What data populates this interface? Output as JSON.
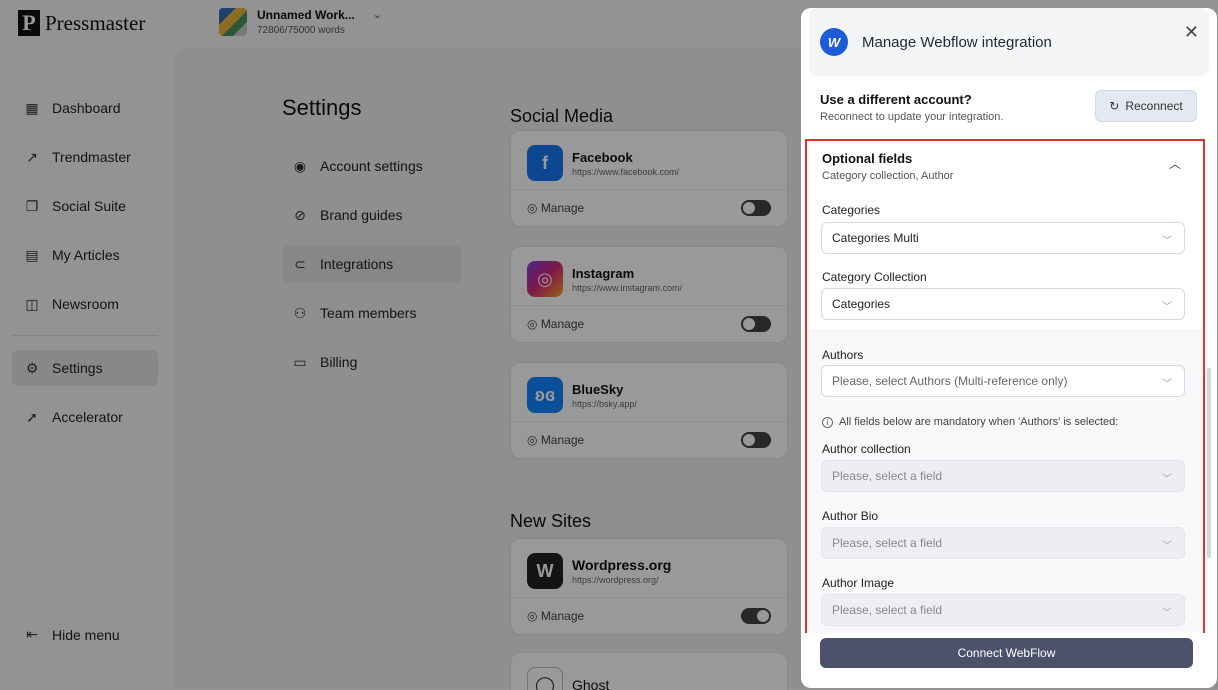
{
  "app": {
    "logo_letter": "P",
    "logo_text": "Pressmaster",
    "workspace_name": "Unnamed Work...",
    "workspace_words": "72806/75000 words"
  },
  "sidebar": {
    "items": [
      {
        "label": "Dashboard",
        "icon": "grid-icon"
      },
      {
        "label": "Trendmaster",
        "icon": "trend-icon"
      },
      {
        "label": "Social Suite",
        "icon": "stack-icon"
      },
      {
        "label": "My Articles",
        "icon": "article-icon"
      },
      {
        "label": "Newsroom",
        "icon": "newsroom-icon"
      },
      {
        "label": "Settings",
        "icon": "gear-icon"
      },
      {
        "label": "Accelerator",
        "icon": "rocket-icon"
      }
    ],
    "hide_menu": "Hide menu"
  },
  "settings": {
    "title": "Settings",
    "menu": [
      "Account settings",
      "Brand guides",
      "Integrations",
      "Team members",
      "Billing"
    ]
  },
  "social_media": {
    "title": "Social Media",
    "cards": [
      {
        "name": "Facebook",
        "url": "https://www.facebook.com/",
        "manage": "Manage",
        "color": "#1877f2"
      },
      {
        "name": "Instagram",
        "url": "https://www.instagram.com/",
        "manage": "Manage",
        "color": "#d6287a"
      },
      {
        "name": "BlueSky",
        "url": "https://bsky.app/",
        "manage": "Manage",
        "color": "#1185fe"
      }
    ]
  },
  "new_sites": {
    "title": "New Sites",
    "cards": [
      {
        "name": "Wordpress.org",
        "url": "https://wordpress.org/",
        "manage": "Manage"
      },
      {
        "name": "Ghost",
        "url": "",
        "manage": ""
      }
    ]
  },
  "modal": {
    "title": "Manage Webflow integration",
    "account_title": "Use a different account?",
    "account_sub": "Reconnect to update your integration.",
    "reconnect": "Reconnect",
    "optional_title": "Optional fields",
    "optional_sub": "Category collection, Author",
    "categories_label": "Categories",
    "categories_value": "Categories Multi",
    "category_collection_label": "Category Collection",
    "category_collection_value": "Categories",
    "authors_label": "Authors",
    "authors_placeholder": "Please, select Authors (Multi-reference only)",
    "info_note": "All fields below are mandatory when 'Authors' is selected:",
    "author_collection_label": "Author collection",
    "author_bio_label": "Author Bio",
    "author_image_label": "Author Image",
    "field_placeholder": "Please, select a field",
    "connect_button": "Connect WebFlow",
    "highlight_color": "#e0342b"
  }
}
